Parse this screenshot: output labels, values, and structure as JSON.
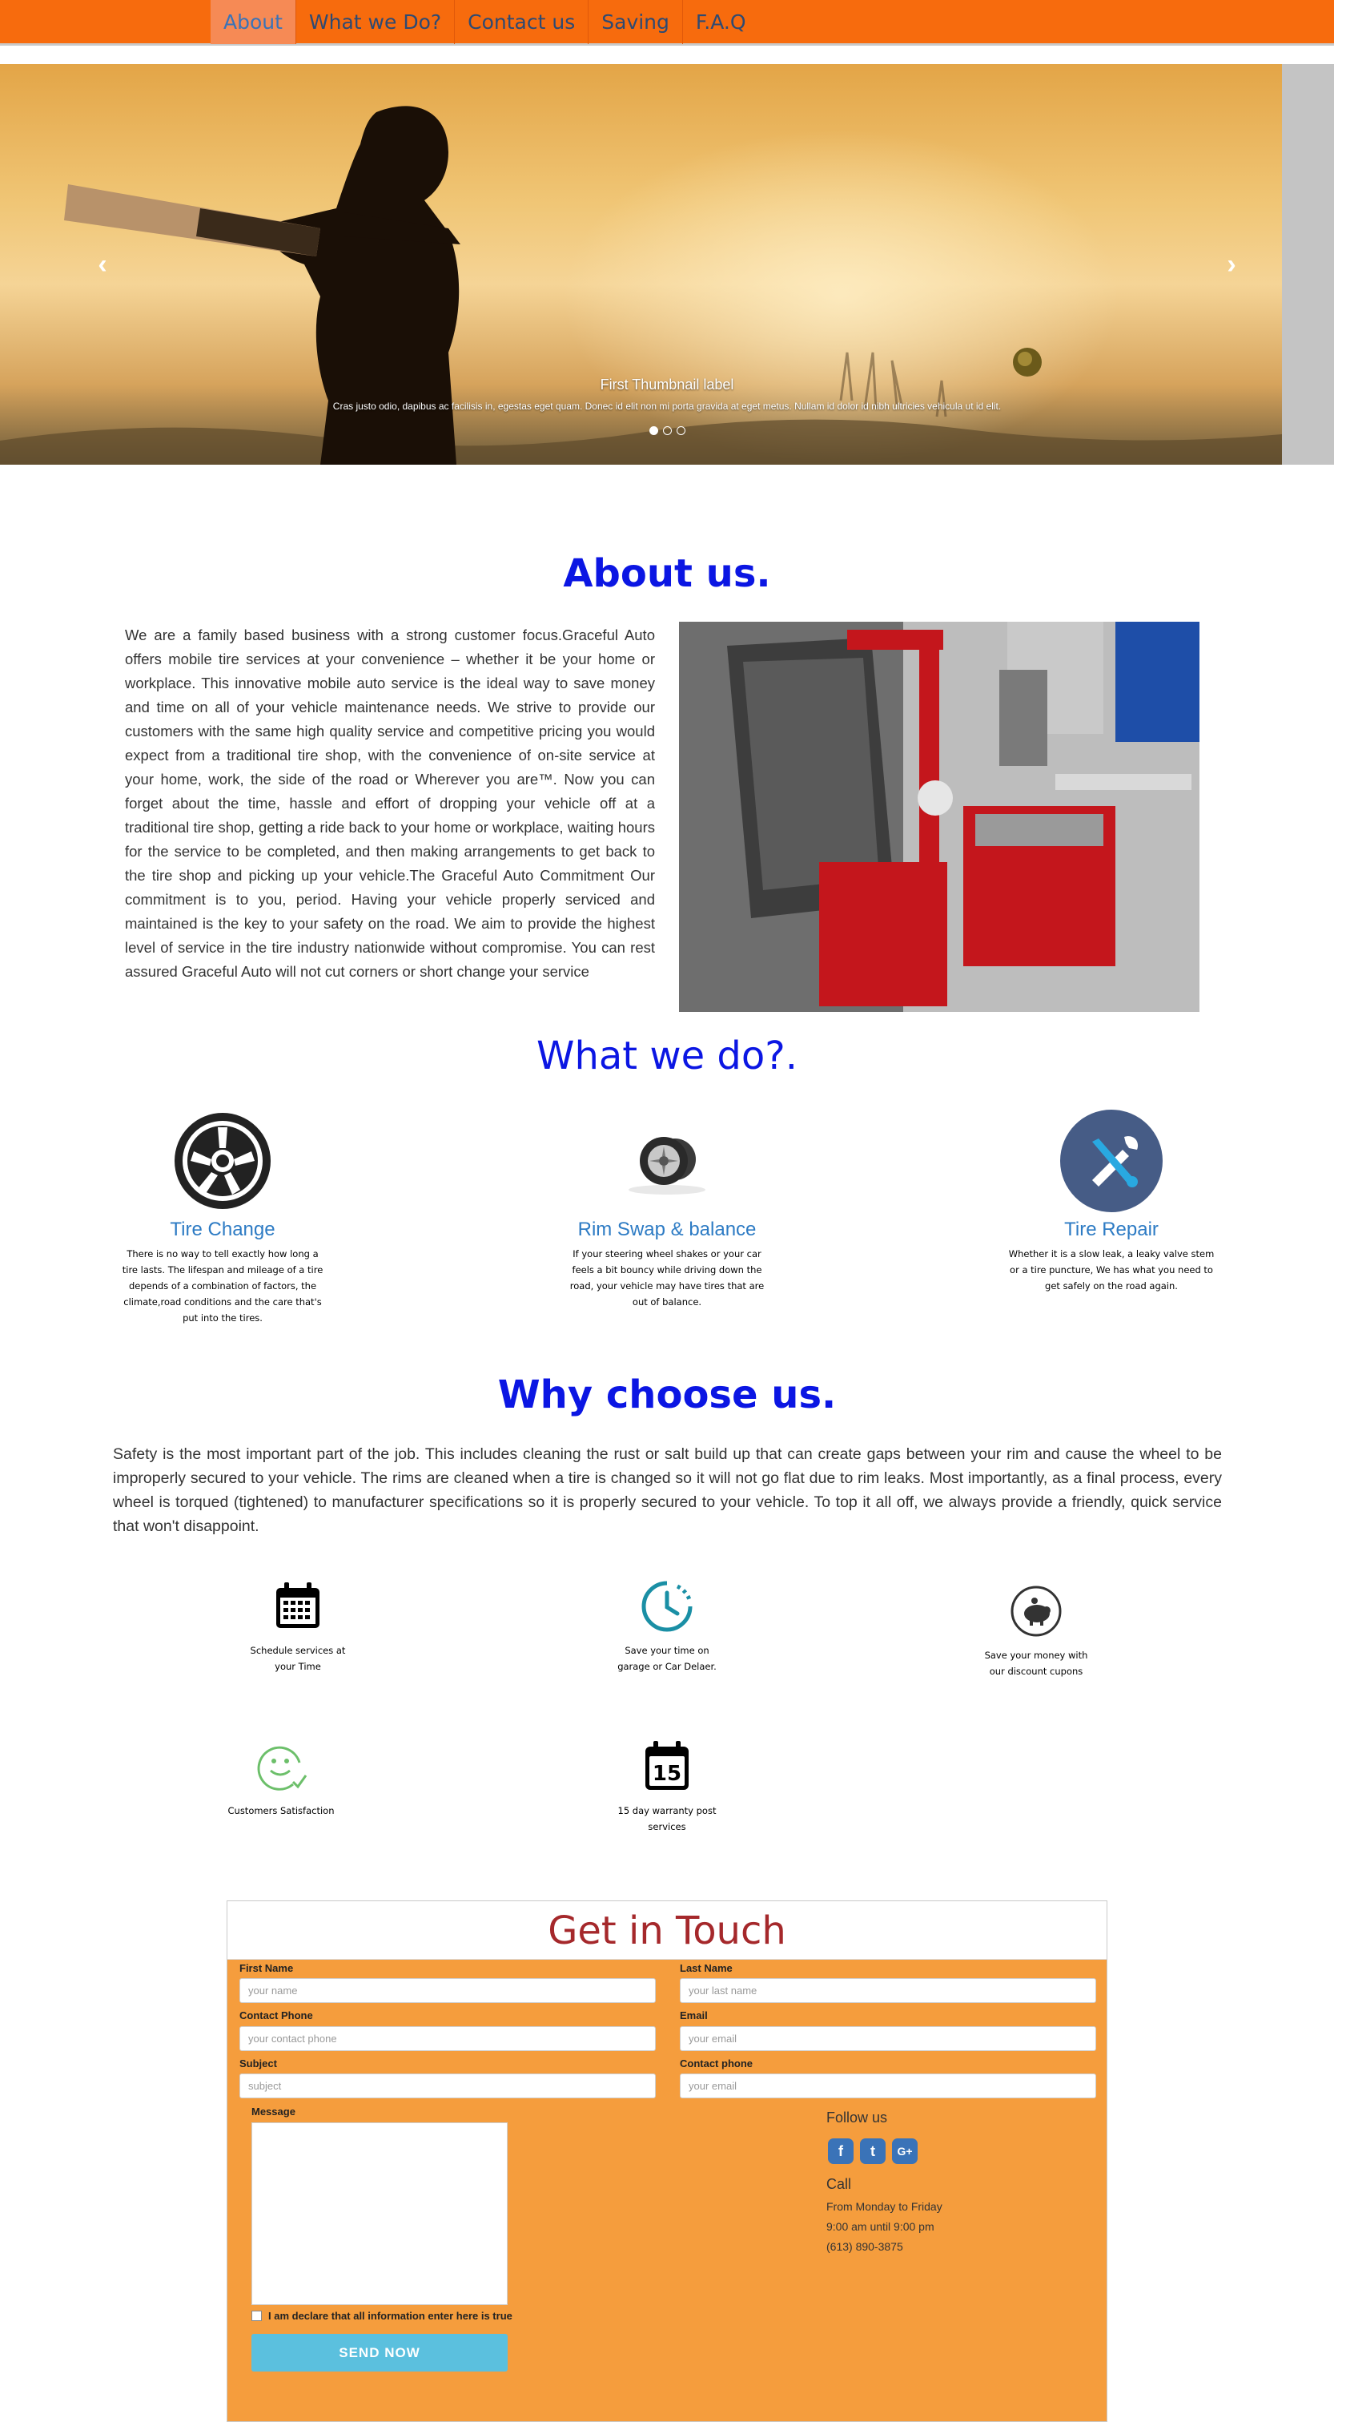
{
  "nav": {
    "items": [
      {
        "label": "About"
      },
      {
        "label": "What we Do?"
      },
      {
        "label": "Contact us"
      },
      {
        "label": "Saving"
      },
      {
        "label": "F.A.Q"
      }
    ]
  },
  "carousel": {
    "caption_title": "First Thumbnail label",
    "caption_text": "Cras justo odio, dapibus ac facilisis in, egestas eget quam. Donec id elit non mi porta gravida at eget metus. Nullam id dolor id nibh ultricies vehicula ut id elit.",
    "prev_icon": "chevron-left-icon",
    "next_icon": "chevron-right-icon"
  },
  "about": {
    "heading": "About us.",
    "text": "We are a family based business with a strong customer focus.Graceful Auto offers mobile tire services at your convenience – whether it be your home or workplace. This innovative mobile auto service is the ideal way to save money and time on all of your vehicle maintenance needs. We strive to provide our customers with the same high quality service and competitive pricing you would expect from a traditional tire shop, with the convenience of on-site service at your home, work, the side of the road or Wherever you are™. Now you can forget about the time, hassle and effort of dropping your vehicle off at a traditional tire shop, getting a ride back to your home or workplace, waiting hours for the service to be completed, and then making arrangements to get back to the tire shop and picking up your vehicle.The Graceful Auto Commitment Our commitment is to you, period. Having your vehicle properly serviced and maintained is the key to your safety on the road. We aim to provide the highest level of service in the tire industry nationwide without compromise. You can rest assured Graceful Auto will not cut corners or short change your service"
  },
  "services": {
    "heading": "What we do?.",
    "items": [
      {
        "title": "Tire Change",
        "desc": "There is no way to tell exactly how long a tire lasts. The lifespan and mileage of a tire depends of a combination of factors, the climate,road conditions and the care that's put into the tires.",
        "icon": "wheel-icon"
      },
      {
        "title": "Rim Swap & balance",
        "desc": "If your steering wheel shakes or your car feels a bit bouncy while driving down the road, your vehicle may have tires that are out of balance.",
        "icon": "rim-icon"
      },
      {
        "title": "Tire Repair",
        "desc": "Whether it is a slow leak, a leaky valve stem or a tire puncture, We has what you need to get safely on the road again.",
        "icon": "tools-icon"
      }
    ]
  },
  "why": {
    "heading": "Why choose us.",
    "text": "Safety is the most important part of the job. This includes cleaning the rust or salt build up that can create gaps between your rim and cause the wheel to be improperly secured to your vehicle. The rims are cleaned when a tire is changed so it will not go flat due to rim leaks. Most importantly, as a final process, every wheel is torqued (tightened) to manufacturer specifications so it is properly secured to your vehicle. To top it all off, we always provide a friendly, quick service that won't disappoint.",
    "features": [
      {
        "text": "Schedule services at your Time",
        "icon": "calendar-icon"
      },
      {
        "text": "Save your time on garage or Car Delaer.",
        "icon": "clock-icon"
      },
      {
        "text": "Save your money with our discount cupons",
        "icon": "piggy-bank-icon"
      },
      {
        "text": "Customers Satisfaction",
        "icon": "smiley-icon"
      },
      {
        "text": "15 day warranty post services",
        "icon": "calendar-15-icon"
      }
    ]
  },
  "contact": {
    "heading": "Get in Touch",
    "first_name_label": "First Name",
    "first_name_placeholder": "your name",
    "last_name_label": "Last Name",
    "last_name_placeholder": "your last name",
    "contact_phone_label": "Contact Phone",
    "contact_phone_placeholder": "your contact phone",
    "email_label": "Email",
    "email_placeholder": "your email",
    "subject_label": "Subject",
    "subject_placeholder": "subject",
    "contact_phone2_label": "Contact phone",
    "contact_phone2_placeholder": "your email",
    "message_label": "Message",
    "declare_label": "I am declare that all information enter here is true",
    "send_label": "SEND NOW",
    "follow_label": "Follow us",
    "call_label": "Call",
    "hours_days": "From Monday to Friday",
    "hours_time": "9:00 am until 9:00 pm",
    "phone": "(613) 890-3875",
    "brand_color": "#f59d3d"
  }
}
